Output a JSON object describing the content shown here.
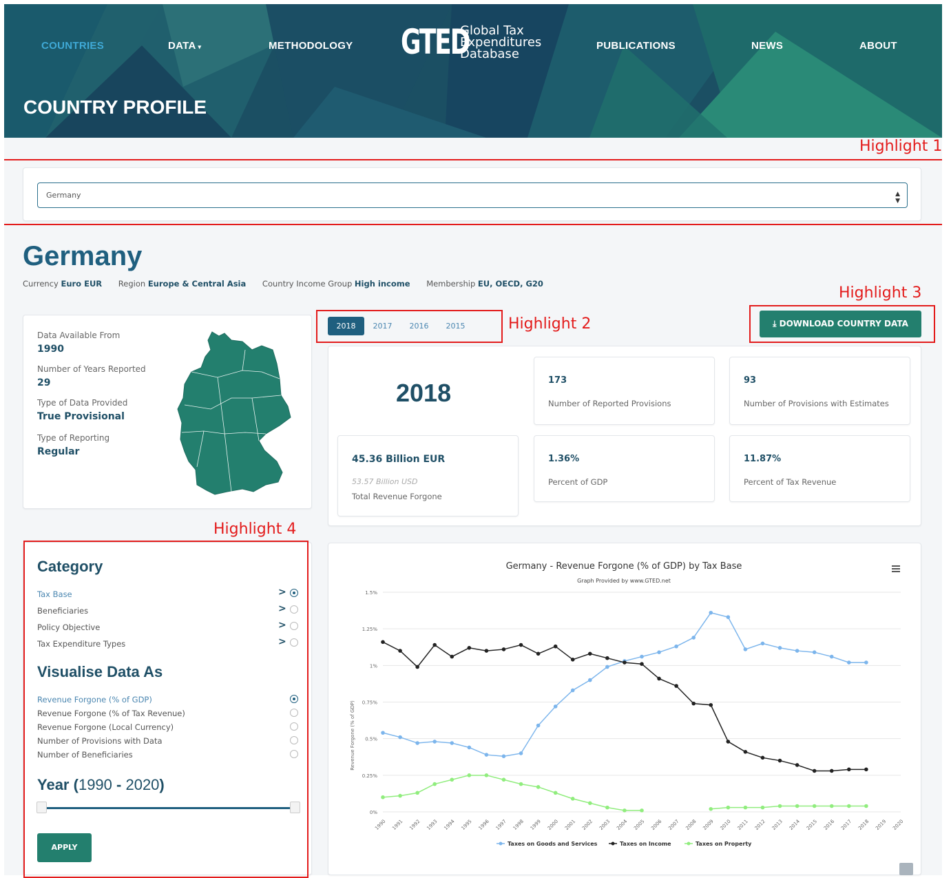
{
  "nav": {
    "countries": "COUNTRIES",
    "data": "DATA",
    "methodology": "METHODOLOGY",
    "publications": "PUBLICATIONS",
    "news": "NEWS",
    "about": "ABOUT"
  },
  "logo": {
    "mark": "GTED",
    "line1": "Global Tax",
    "line2": "Expenditures",
    "line3": "Database"
  },
  "page_title": "COUNTRY PROFILE",
  "highlights": {
    "h1": "Highlight 1",
    "h2": "Highlight 2",
    "h3": "Highlight 3",
    "h4": "Highlight 4"
  },
  "country_select": {
    "value": "Germany"
  },
  "country": {
    "name": "Germany",
    "currency_label": "Currency",
    "currency": "Euro EUR",
    "region_label": "Region",
    "region": "Europe & Central Asia",
    "income_label": "Country Income Group",
    "income": "High income",
    "membership_label": "Membership",
    "membership": "EU, OECD, G20"
  },
  "info": {
    "from_label": "Data Available From",
    "from": "1990",
    "years_label": "Number of Years Reported",
    "years": "29",
    "type_label": "Type of Data Provided",
    "type": "True Provisional",
    "reporting_label": "Type of Reporting",
    "reporting": "Regular"
  },
  "year_tabs": [
    "2018",
    "2017",
    "2016",
    "2015"
  ],
  "download_label": "DOWNLOAD COUNTRY DATA",
  "stats": {
    "year": "2018",
    "provisions": "173",
    "provisions_label": "Number of Reported Provisions",
    "estimates": "93",
    "estimates_label": "Number of Provisions with Estimates",
    "revenue": "45.36 Billion EUR",
    "revenue_usd": "53.57 Billion USD",
    "revenue_label": "Total Revenue Forgone",
    "gdp": "1.36%",
    "gdp_label": "Percent of GDP",
    "tax": "11.87%",
    "tax_label": "Percent of Tax Revenue"
  },
  "sidebar": {
    "category_title": "Category",
    "categories": [
      "Tax Base",
      "Beneficiaries",
      "Policy Objective",
      "Tax Expenditure Types"
    ],
    "visualise_title": "Visualise Data As",
    "visualise": [
      "Revenue Forgone (% of GDP)",
      "Revenue Forgone (% of Tax Revenue)",
      "Revenue Forgone (Local Currency)",
      "Number of Provisions with Data",
      "Number of Beneficiaries"
    ],
    "year_title": "Year",
    "year_from": "1990",
    "year_to": "2020",
    "apply": "APPLY"
  },
  "chart_data": {
    "type": "line",
    "title": "Germany - Revenue Forgone (% of GDP) by Tax Base",
    "subtitle": "Graph Provided by www.GTED.net",
    "ylabel": "Revenue Forgone (% of GDP)",
    "ylim": [
      0,
      1.5
    ],
    "yticks": [
      "0%",
      "0.25%",
      "0.5%",
      "0.75%",
      "1%",
      "1.25%",
      "1.5%"
    ],
    "x": [
      "1990",
      "1991",
      "1992",
      "1993",
      "1994",
      "1995",
      "1996",
      "1997",
      "1998",
      "1999",
      "2000",
      "2001",
      "2002",
      "2003",
      "2004",
      "2005",
      "2006",
      "2007",
      "2008",
      "2009",
      "2010",
      "2011",
      "2012",
      "2013",
      "2014",
      "2015",
      "2016",
      "2017",
      "2018",
      "2019",
      "2020"
    ],
    "series": [
      {
        "name": "Taxes on Goods and Services",
        "color": "#7cb5ec",
        "values": [
          0.54,
          0.51,
          0.47,
          0.48,
          0.47,
          0.44,
          0.39,
          0.38,
          0.4,
          0.59,
          0.72,
          0.83,
          0.9,
          0.99,
          1.03,
          1.06,
          1.09,
          1.13,
          1.19,
          1.36,
          1.33,
          1.11,
          1.15,
          1.12,
          1.1,
          1.09,
          1.06,
          1.02,
          1.02,
          null,
          null
        ]
      },
      {
        "name": "Taxes on Income",
        "color": "#222222",
        "values": [
          1.16,
          1.1,
          0.99,
          1.14,
          1.06,
          1.12,
          1.1,
          1.11,
          1.14,
          1.08,
          1.13,
          1.04,
          1.08,
          1.05,
          1.02,
          1.01,
          0.91,
          0.86,
          0.74,
          0.73,
          0.48,
          0.41,
          0.37,
          0.35,
          0.32,
          0.28,
          0.28,
          0.29,
          0.29,
          null,
          null
        ]
      },
      {
        "name": "Taxes on Property",
        "color": "#90ed7d",
        "values": [
          0.1,
          0.11,
          0.13,
          0.19,
          0.22,
          0.25,
          0.25,
          0.22,
          0.19,
          0.17,
          0.13,
          0.09,
          0.06,
          0.03,
          0.01,
          0.01,
          null,
          null,
          null,
          0.02,
          0.03,
          0.03,
          0.03,
          0.04,
          0.04,
          0.04,
          0.04,
          0.04,
          0.04,
          null,
          null
        ]
      }
    ]
  }
}
